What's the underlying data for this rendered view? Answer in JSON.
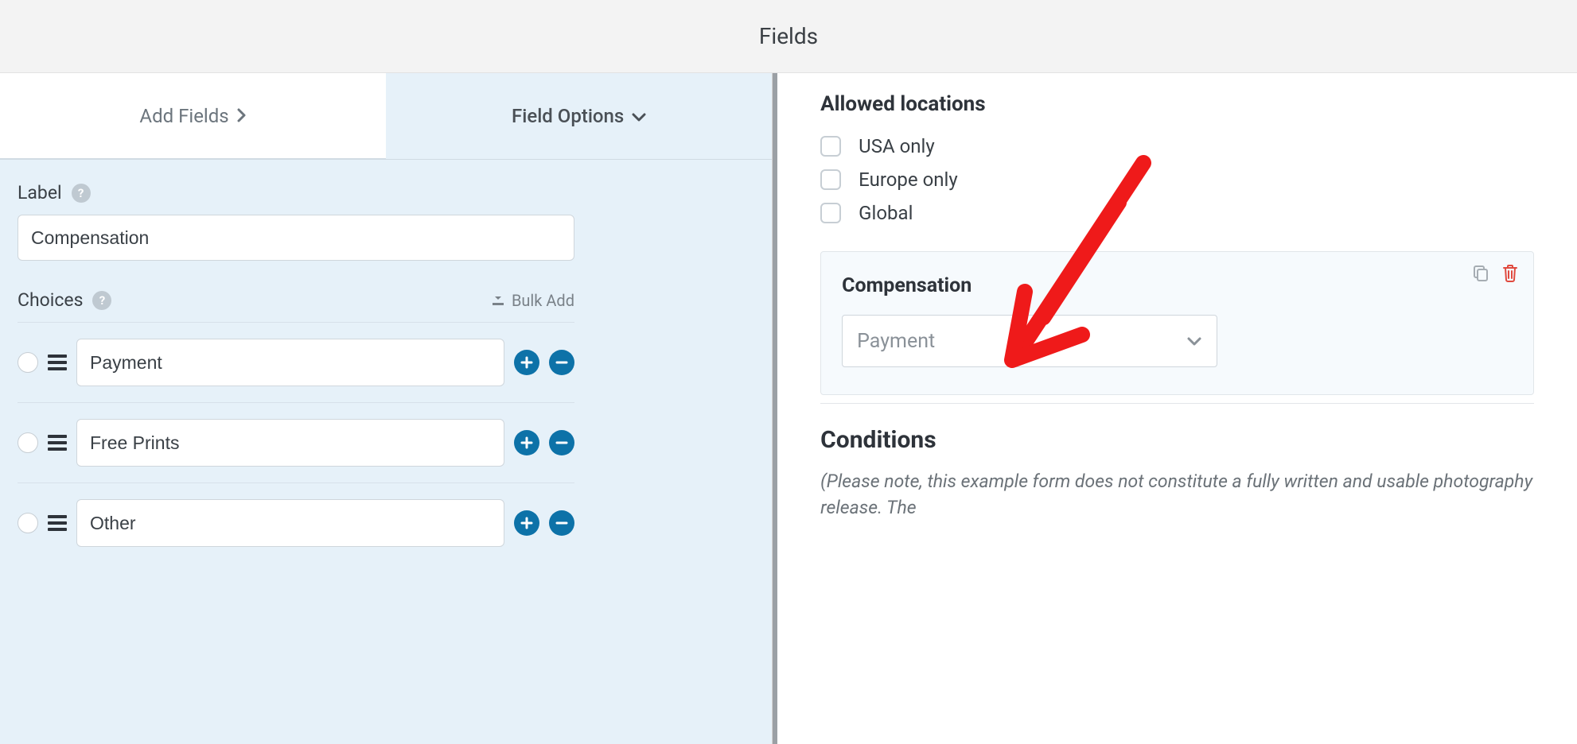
{
  "header": {
    "title": "Fields"
  },
  "tabs": {
    "add_fields": "Add Fields",
    "field_options": "Field Options"
  },
  "left": {
    "label_section": "Label",
    "label_value": "Compensation",
    "choices_section": "Choices",
    "bulk_add_label": "Bulk Add",
    "choices": [
      {
        "value": "Payment"
      },
      {
        "value": "Free Prints"
      },
      {
        "value": "Other"
      }
    ]
  },
  "right": {
    "allowed_locations_heading": "Allowed locations",
    "locations": [
      {
        "label": "USA only"
      },
      {
        "label": "Europe only"
      },
      {
        "label": "Global"
      }
    ],
    "card": {
      "title": "Compensation",
      "selected_value": "Payment"
    },
    "conditions_heading": "Conditions",
    "conditions_note": "(Please note, this example form does not constitute a fully written and usable photography release. The"
  },
  "colors": {
    "accent_blue": "#0d72a8",
    "panel_blue": "#e6f1f9",
    "annotation_red": "#ef1a1a"
  }
}
